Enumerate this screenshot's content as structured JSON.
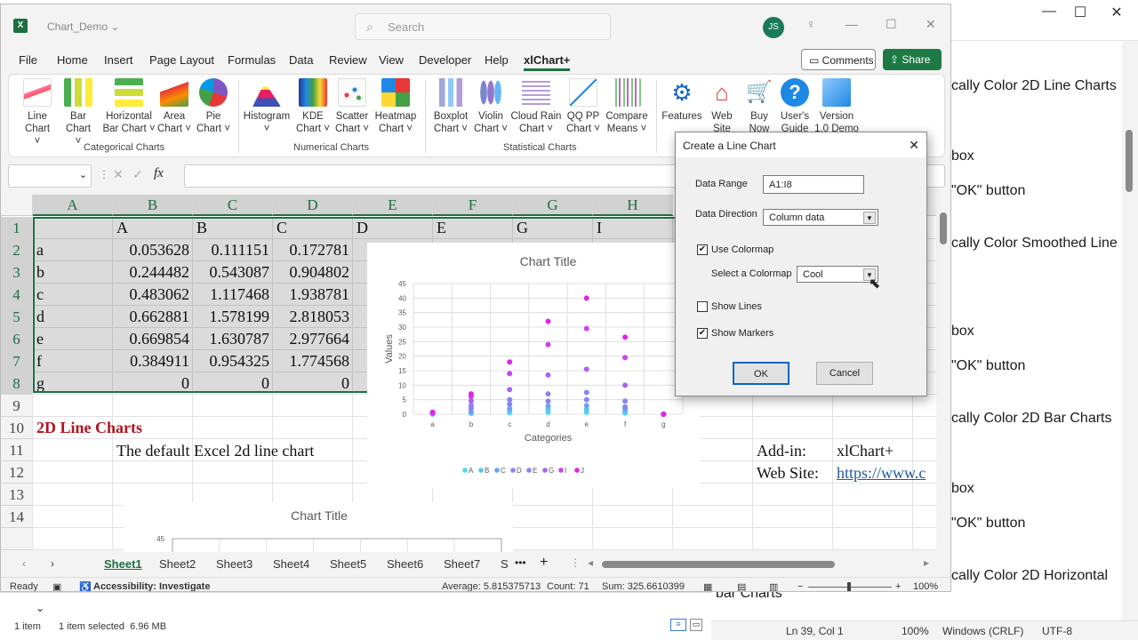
{
  "notepad": {
    "lines": [
      "cally Color 2D Line Charts",
      "box",
      "\"OK\" button",
      "cally Color Smoothed Line",
      "box",
      "\"OK\" button",
      "cally Color 2D Bar Charts",
      "box",
      "\"OK\" button",
      "cally Color 2D Horizontal",
      "bar Charts"
    ],
    "status": {
      "position": "Ln 39, Col 1",
      "zoom": "100%",
      "line_ending": "Windows (CRLF)",
      "encoding": "UTF-8"
    }
  },
  "explorer": {
    "count": "1 item",
    "selected": "1 item selected  6.96 MB"
  },
  "excel": {
    "doc_title": "Chart_Demo",
    "search_placeholder": "Search",
    "avatar": "JS",
    "menu": [
      "File",
      "Home",
      "Insert",
      "Page Layout",
      "Formulas",
      "Data",
      "Review",
      "View",
      "Developer",
      "Help",
      "xlChart+"
    ],
    "comments": "Comments",
    "share": "Share",
    "ribbon": {
      "groups": [
        "Categorical Charts",
        "Numerical Charts",
        "Statistical Charts"
      ],
      "buttons": [
        {
          "l1": "Line",
          "l2": "Chart ˅"
        },
        {
          "l1": "Bar",
          "l2": "Chart ˅"
        },
        {
          "l1": "Horizontal",
          "l2": "Bar Chart ˅"
        },
        {
          "l1": "Area",
          "l2": "Chart ˅"
        },
        {
          "l1": "Pie",
          "l2": "Chart ˅"
        },
        {
          "l1": "Histogram",
          "l2": "˅"
        },
        {
          "l1": "KDE",
          "l2": "Chart ˅"
        },
        {
          "l1": "Scatter",
          "l2": "Chart ˅"
        },
        {
          "l1": "Heatmap",
          "l2": "Chart ˅"
        },
        {
          "l1": "Boxplot",
          "l2": "Chart ˅"
        },
        {
          "l1": "Violin",
          "l2": "Chart ˅"
        },
        {
          "l1": "Cloud Rain",
          "l2": "Chart ˅"
        },
        {
          "l1": "QQ PP",
          "l2": "Chart ˅"
        },
        {
          "l1": "Compare",
          "l2": "Means ˅"
        },
        {
          "l1": "Features",
          "l2": ""
        },
        {
          "l1": "Web",
          "l2": "Site"
        },
        {
          "l1": "Buy",
          "l2": "Now"
        },
        {
          "l1": "User's",
          "l2": "Guide"
        },
        {
          "l1": "Version",
          "l2": "1.0 Demo"
        }
      ]
    },
    "columns": [
      "A",
      "B",
      "C",
      "D",
      "E",
      "F",
      "G",
      "H"
    ],
    "rows": [
      "1",
      "2",
      "3",
      "4",
      "5",
      "6",
      "7",
      "8",
      "9",
      "10",
      "11",
      "12",
      "13",
      "14"
    ],
    "header_row": [
      "A",
      "B",
      "C",
      "D",
      "E",
      "G",
      "I"
    ],
    "data": [
      {
        "label": "a",
        "v": [
          "0.053628",
          "0.111151",
          "0.172781"
        ]
      },
      {
        "label": "b",
        "v": [
          "0.244482",
          "0.543087",
          "0.904802"
        ]
      },
      {
        "label": "c",
        "v": [
          "0.483062",
          "1.117468",
          "1.938781"
        ]
      },
      {
        "label": "d",
        "v": [
          "0.662881",
          "1.578199",
          "2.818053"
        ]
      },
      {
        "label": "e",
        "v": [
          "0.669854",
          "1.630787",
          "2.977664"
        ]
      },
      {
        "label": "f",
        "v": [
          "0.384911",
          "0.954325",
          "1.774568"
        ]
      },
      {
        "label": "g",
        "v": [
          "0",
          "0",
          "0"
        ]
      }
    ],
    "section_title": "2D Line Charts",
    "section_desc": "The default Excel 2d line chart",
    "addin_label": "Add-in:",
    "addin_value": "xlChart+",
    "website_label": "Web Site:",
    "website_value": "https://www.c",
    "sheets": [
      "Sheet1",
      "Sheet2",
      "Sheet3",
      "Sheet4",
      "Sheet5",
      "Sheet6",
      "Sheet7",
      "S"
    ],
    "status": {
      "ready": "Ready",
      "accessibility": "Accessibility: Investigate",
      "average": "Average: 5.815375713",
      "count": "Count: 71",
      "sum": "Sum: 325.6610399",
      "zoom": "100%"
    }
  },
  "chart_data": [
    {
      "type": "scatter",
      "title": "Chart Title",
      "xlabel": "Categories",
      "ylabel": "Values",
      "categories": [
        "a",
        "b",
        "c",
        "d",
        "e",
        "f",
        "g"
      ],
      "ylim": [
        0,
        45
      ],
      "yticks": [
        "0",
        "5",
        "10",
        "15",
        "20",
        "25",
        "30",
        "35",
        "40",
        "45"
      ],
      "legend": "bottom",
      "colors": [
        "#4fd8f0",
        "#5ec4f0",
        "#6aa4f0",
        "#8a84f0",
        "#a864f0",
        "#c844f0",
        "#e024e8"
      ],
      "series": [
        {
          "name": "A",
          "values": [
            0.05,
            0.24,
            0.48,
            0.66,
            0.67,
            0.38,
            0
          ]
        },
        {
          "name": "B",
          "values": [
            0.11,
            0.54,
            1.12,
            1.58,
            1.63,
            0.95,
            0
          ]
        },
        {
          "name": "C",
          "values": [
            0.17,
            0.9,
            1.94,
            2.82,
            2.98,
            1.77,
            0
          ]
        },
        {
          "name": "D",
          "values": [
            0.3,
            2,
            3.5,
            4.5,
            5,
            2.5,
            0
          ]
        },
        {
          "name": "E",
          "values": [
            0.4,
            3,
            5,
            7,
            7.5,
            4.5,
            0
          ]
        },
        {
          "name": "G",
          "values": [
            0.5,
            4.5,
            8.5,
            13.5,
            15.5,
            10,
            0
          ]
        },
        {
          "name": "I",
          "values": [
            0.6,
            6,
            14,
            24,
            29.5,
            19.5,
            0
          ]
        },
        {
          "name": "J",
          "values": [
            0.7,
            7,
            18,
            32,
            40,
            26.5,
            0
          ]
        }
      ]
    },
    {
      "type": "line",
      "title": "Chart Title",
      "yticks": [
        "45"
      ]
    }
  ],
  "dialog": {
    "title": "Create a Line Chart",
    "data_range_label": "Data Range",
    "data_range_value": "A1:I8",
    "direction_label": "Data Direction",
    "direction_value": "Column data",
    "use_colormap_label": "Use Colormap",
    "use_colormap": true,
    "select_colormap_label": "Select a Colormap",
    "colormap_value": "Cool",
    "show_lines_label": "Show Lines",
    "show_lines": false,
    "show_markers_label": "Show Markers",
    "show_markers": true,
    "ok": "OK",
    "cancel": "Cancel"
  }
}
